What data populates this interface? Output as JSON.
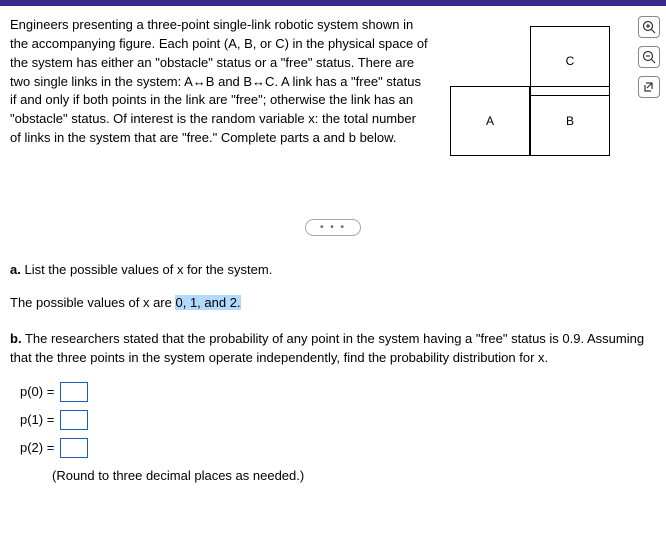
{
  "problem": {
    "text": "Engineers presenting a three-point single-link robotic system shown in the accompanying figure. Each point (A, B, or C) in the physical space of the system has either an \"obstacle\" status or a \"free\" status. There are two single links in the system: A↔B and B↔C. A link has a \"free\" status if and only if both points in the link are \"free\"; otherwise the link has an \"obstacle\" status. Of interest is the random variable x: the total number of links in the system that are \"free.\" Complete parts a and b below."
  },
  "figure": {
    "labelA": "A",
    "labelB": "B",
    "labelC": "C"
  },
  "divider": {
    "dots": "• • •"
  },
  "partA": {
    "label": "a.",
    "prompt": "List the possible values of x for the system.",
    "answerPrefix": "The possible values of x are ",
    "answerValue": "0, 1, and 2."
  },
  "partB": {
    "label": "b.",
    "prompt": "The researchers stated that the probability of any point in the system having a \"free\" status is 0.9. Assuming that the three points in the system operate independently, find the probability distribution for x.",
    "rows": [
      {
        "label": "p(0) =",
        "value": ""
      },
      {
        "label": "p(1) =",
        "value": ""
      },
      {
        "label": "p(2) =",
        "value": ""
      }
    ],
    "roundNote": "(Round to three decimal places as needed.)"
  },
  "tools": {
    "zoomIn": "zoom-in",
    "zoomOut": "zoom-out",
    "popout": "popout"
  }
}
